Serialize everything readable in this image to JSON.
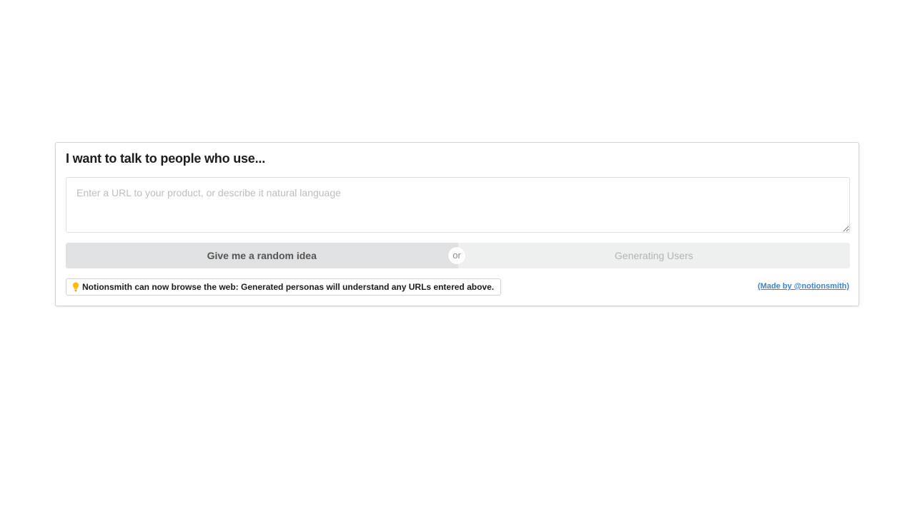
{
  "form": {
    "title": "I want to talk to people who use...",
    "input_placeholder": "Enter a URL to your product, or describe it natural language",
    "input_value": ""
  },
  "buttons": {
    "random_label": "Give me a random idea",
    "or_label": "or",
    "generate_label": "Generating Users"
  },
  "notice": {
    "icon": "lightbulb-icon",
    "text": "Notionsmith can now browse the web: Generated personas will understand any URLs entered above."
  },
  "credit": {
    "text": "(Made by @notionsmith)"
  },
  "colors": {
    "link": "#4183c4",
    "bulb": "#fbbd08",
    "random_button_bg": "#e0e1e2",
    "generate_button_bg": "#eef0f0"
  }
}
